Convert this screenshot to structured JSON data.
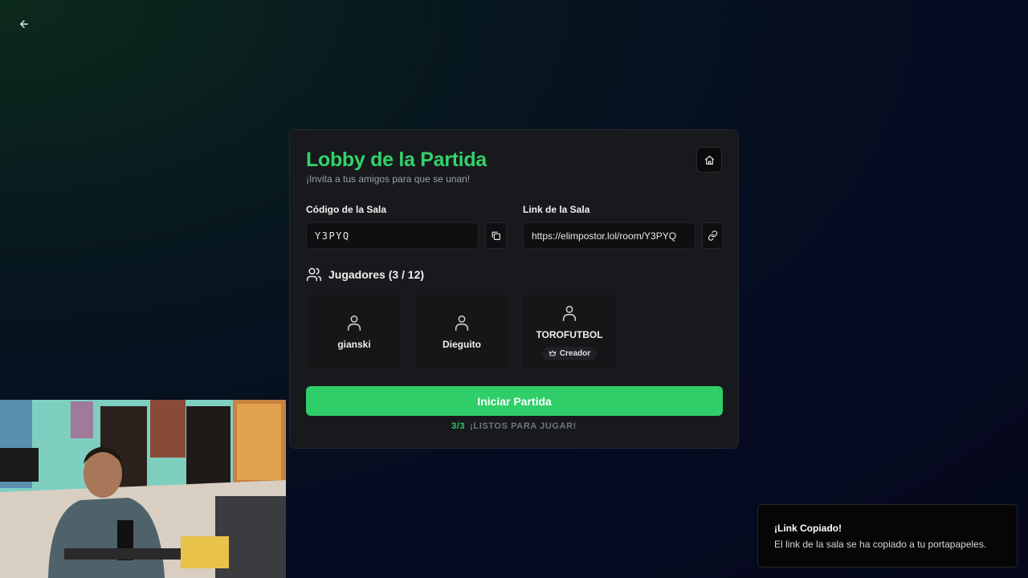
{
  "nav": {
    "back_icon": "arrow-left-icon"
  },
  "lobby": {
    "title": "Lobby de la Partida",
    "subtitle": "¡Invita a tus amigos para que se unan!",
    "home_icon": "home-icon",
    "room_code": {
      "label": "Código de la Sala",
      "value": "Y3PYQ",
      "icon": "copy-icon"
    },
    "room_link": {
      "label": "Link de la Sala",
      "value": "https://elimpostor.lol/room/Y3PYQ",
      "icon": "link-icon"
    },
    "players": {
      "title": "Jugadores (3 / 12)",
      "icon": "users-icon",
      "list": [
        {
          "name": "gianski",
          "badge": ""
        },
        {
          "name": "Dieguito",
          "badge": ""
        },
        {
          "name": "TOROFUTBOL",
          "badge": "Creador"
        }
      ]
    },
    "start_button": "Iniciar Partida",
    "ready_count": "3/3",
    "ready_text": "¡LISTOS PARA JUGAR!"
  },
  "toast": {
    "title": "¡Link Copiado!",
    "description": "El link de la sala se ha copiado a tu portapapeles."
  },
  "colors": {
    "accent": "#2fce69",
    "title": "#33d26b",
    "card_bg": "#18191c",
    "page_bg": "#05081c"
  }
}
